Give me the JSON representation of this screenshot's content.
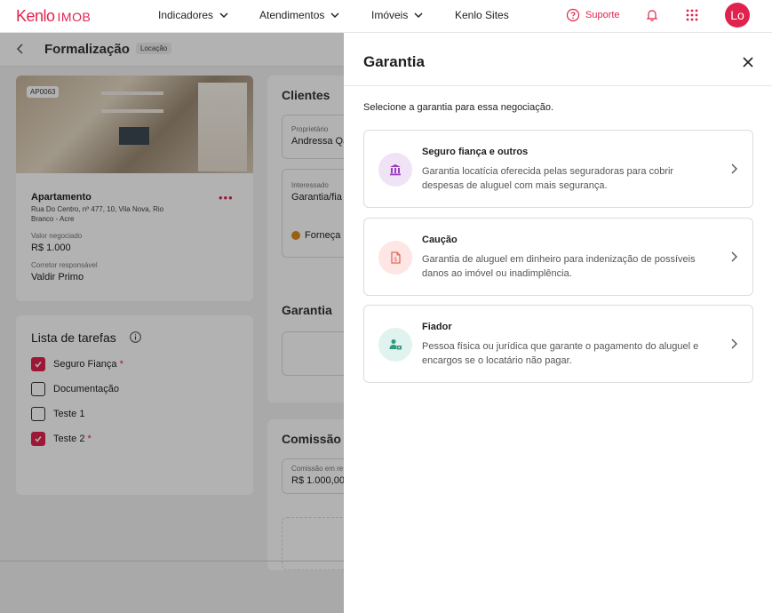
{
  "topbar": {
    "logo_brand": "Kenlo",
    "logo_product": "IMOB",
    "nav": [
      {
        "label": "Indicadores"
      },
      {
        "label": "Atendimentos"
      },
      {
        "label": "Imóveis"
      },
      {
        "label": "Kenlo Sites"
      }
    ],
    "support_label": "Suporte",
    "avatar_initials": "Lo",
    "accent_color": "#e0234e"
  },
  "page": {
    "title": "Formalização",
    "tag": "Locação",
    "property": {
      "code": "AP0063",
      "type": "Apartamento",
      "address": "Rua Do Centro, nº 477, 10, Vila Nova, Rio Branco - Acre",
      "value_label": "Valor negociado",
      "value": "R$ 1.000",
      "broker_label": "Corretor responsável",
      "broker": "Valdir Primo"
    },
    "tasks": {
      "title": "Lista de tarefas",
      "items": [
        {
          "label": "Seguro Fiança",
          "checked": true,
          "required": "*"
        },
        {
          "label": "Documentação",
          "checked": false,
          "required": ""
        },
        {
          "label": "Teste 1",
          "checked": false,
          "required": ""
        },
        {
          "label": "Teste 2",
          "checked": true,
          "required": "*"
        }
      ]
    },
    "clients": {
      "title": "Clientes",
      "owner_label": "Proprietário",
      "owner_value": "Andressa Qa",
      "interested_label": "Interessado",
      "interested_value": "Garantia/fia",
      "provide_label": "Forneça"
    },
    "guarantee": {
      "title": "Garantia"
    },
    "commission": {
      "title": "Comissão",
      "label": "Comissão em re",
      "value": "R$ 1.000,00"
    }
  },
  "drawer": {
    "title": "Garantia",
    "subtitle": "Selecione a garantia para essa negociação.",
    "options": [
      {
        "title": "Seguro fiança e outros",
        "description": "Garantia locatícia oferecida pelas seguradoras para cobrir despesas de aluguel com mais segurança.",
        "icon": "bank-icon",
        "icon_bg": "#efe3f5",
        "icon_color": "#9b3bbf"
      },
      {
        "title": "Caução",
        "description": "Garantia de aluguel em dinheiro para indenização de possíveis danos ao imóvel ou inadimplência.",
        "icon": "money-document-icon",
        "icon_bg": "#fde6e4",
        "icon_color": "#e06a5e"
      },
      {
        "title": "Fiador",
        "description": "Pessoa física ou jurídica que garante o pagamento do aluguel e encargos se o locatário não pagar.",
        "icon": "person-money-icon",
        "icon_bg": "#e0f3ee",
        "icon_color": "#2e9a7f"
      }
    ]
  }
}
